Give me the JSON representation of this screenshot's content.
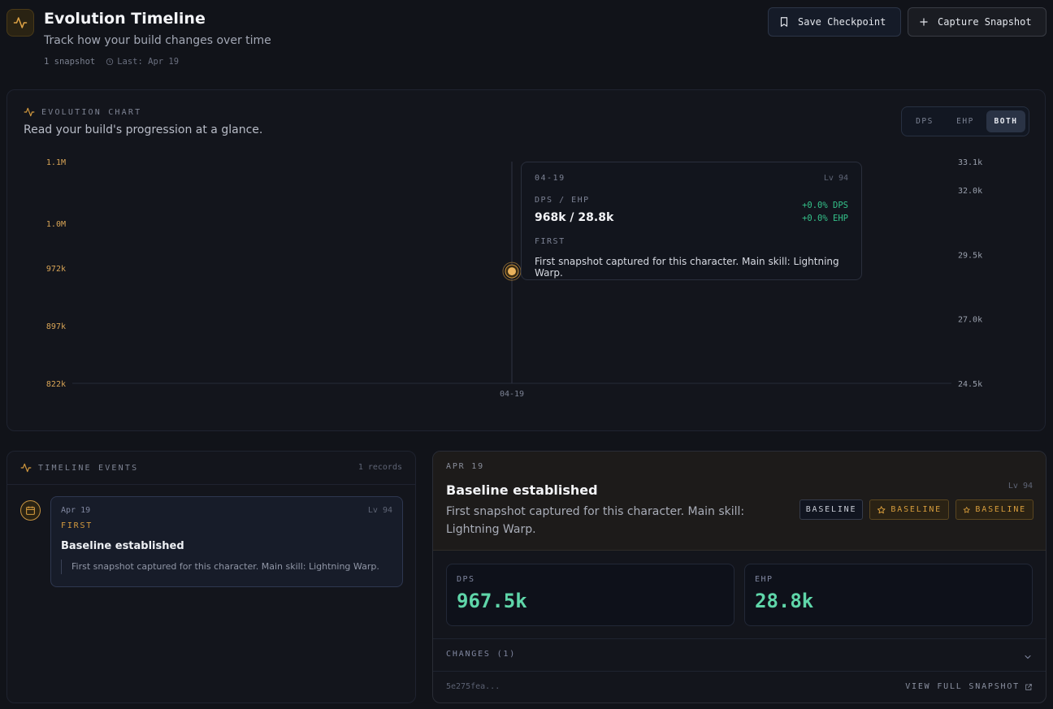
{
  "header": {
    "title": "Evolution Timeline",
    "subtitle": "Track how your build changes over time",
    "snapshot_count": "1 snapshot",
    "last": "Last: Apr 19",
    "save_label": "Save Checkpoint",
    "capture_label": "Capture Snapshot",
    "icons": {
      "logo": "activity-icon",
      "save": "bookmark-icon",
      "capture": "plus-icon",
      "last": "clock-icon"
    }
  },
  "chart": {
    "label": "EVOLUTION CHART",
    "description": "Read your build's progression at a glance.",
    "toggle": [
      "DPS",
      "EHP",
      "BOTH"
    ],
    "toggle_active": "BOTH",
    "tooltip": {
      "date": "04-19",
      "level": "Lv 94",
      "metric": "DPS / EHP",
      "value": "968k / 28.8k",
      "delta_dps": "+0.0% DPS",
      "delta_ehp": "+0.0% EHP",
      "tag": "FIRST",
      "note": "First snapshot captured for this character. Main skill: Lightning Warp."
    }
  },
  "chart_data": {
    "type": "scatter",
    "x": [
      "04-19"
    ],
    "series": [
      {
        "name": "DPS",
        "axis": "left",
        "values": [
          967500
        ]
      },
      {
        "name": "EHP",
        "axis": "right",
        "values": [
          28800
        ]
      }
    ],
    "left_ticks": [
      {
        "label": "1.1M",
        "value": 1110000
      },
      {
        "label": "1.0M",
        "value": 1030000
      },
      {
        "label": "972k",
        "value": 972000
      },
      {
        "label": "897k",
        "value": 897000
      },
      {
        "label": "822k",
        "value": 822000
      }
    ],
    "right_ticks": [
      {
        "label": "33.1k",
        "value": 33100
      },
      {
        "label": "32.0k",
        "value": 32000
      },
      {
        "label": "29.5k",
        "value": 29500
      },
      {
        "label": "27.0k",
        "value": 27000
      },
      {
        "label": "24.5k",
        "value": 24500
      }
    ],
    "ylim_left": [
      822000,
      1110000
    ],
    "ylim_right": [
      24500,
      33100
    ],
    "grid": false,
    "colors": {
      "left_axis": "#d9a556",
      "right_axis": "#9aa0ad",
      "point": "#e9b25c",
      "halo": "#c8923e"
    }
  },
  "timeline": {
    "label": "TIMELINE EVENTS",
    "count": "1 records",
    "item": {
      "date": "Apr 19",
      "level": "Lv 94",
      "tag": "FIRST",
      "title": "Baseline established",
      "note": "First snapshot captured for this character. Main skill: Lightning Warp."
    }
  },
  "detail": {
    "date": "APR 19",
    "title": "Baseline established",
    "description": "First snapshot captured for this character. Main skill: Lightning Warp.",
    "level": "Lv 94",
    "badges": [
      "BASELINE",
      "BASELINE",
      "BASELINE"
    ],
    "dps_label": "DPS",
    "dps_value": "967.5k",
    "ehp_label": "EHP",
    "ehp_value": "28.8k",
    "changes": "CHANGES (1)",
    "hash": "5e275fea...",
    "view_full": "VIEW FULL SNAPSHOT"
  },
  "colors": {
    "accent": "#d49a3e",
    "positive": "#5fd6a9",
    "bg": "#111319"
  }
}
